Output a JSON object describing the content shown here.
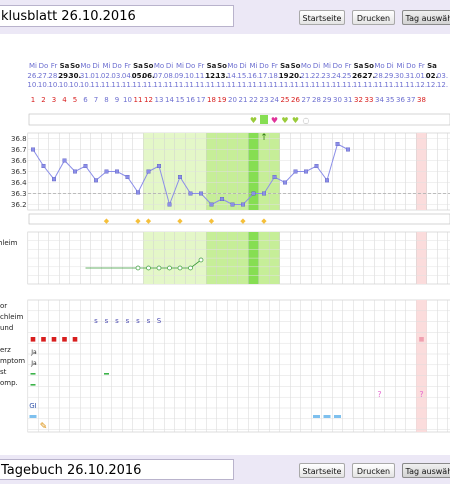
{
  "top": {
    "title": "klusblatt 26.10.2016",
    "buttons": [
      "Startseite",
      "Drucken",
      "Tag auswähl"
    ]
  },
  "bottom": {
    "title": "Tagebuch 26.10.2016",
    "buttons": [
      "Startseite",
      "Drucken",
      "Tag auswähl"
    ]
  },
  "weekdays": [
    "Mi",
    "Do",
    "Fr",
    "Sa",
    "So",
    "Mo",
    "Di",
    "Mi",
    "Do",
    "Fr",
    "Sa",
    "So",
    "Mo",
    "Di",
    "Mi",
    "Do",
    "Fr",
    "Sa",
    "So",
    "Mo",
    "Di",
    "Mi",
    "Do",
    "Fr",
    "Sa",
    "So",
    "Mo",
    "Di",
    "Mi",
    "Do",
    "Fr",
    "Sa",
    "So",
    "Mo",
    "Di",
    "Mi",
    "Do",
    "Fr",
    "Sa"
  ],
  "dates_day": [
    "26.",
    "27.",
    "28.",
    "29.",
    "30.",
    "31.",
    "01.",
    "02.",
    "03.",
    "04.",
    "05.",
    "06.",
    "07.",
    "08.",
    "09.",
    "10.",
    "11.",
    "12.",
    "13.",
    "14.",
    "15.",
    "16.",
    "17.",
    "18.",
    "19.",
    "20.",
    "21.",
    "22.",
    "23.",
    "24.",
    "25.",
    "26.",
    "27.",
    "28.",
    "29.",
    "30.",
    "31.",
    "01.",
    "02.",
    "03."
  ],
  "dates_month": [
    "10.",
    "10.",
    "10.",
    "10.",
    "10.",
    "10.",
    "11.",
    "11.",
    "11.",
    "11.",
    "11.",
    "11.",
    "11.",
    "11.",
    "11.",
    "11.",
    "11.",
    "11.",
    "11.",
    "11.",
    "11.",
    "11.",
    "11.",
    "11.",
    "11.",
    "11.",
    "11.",
    "11.",
    "11.",
    "11.",
    "11.",
    "11.",
    "11.",
    "11.",
    "11.",
    "11.",
    "11.",
    "12.",
    "12.",
    "12."
  ],
  "cycle_days": [
    "1",
    "2",
    "3",
    "4",
    "5",
    "6",
    "7",
    "8",
    "9",
    "10",
    "11",
    "12",
    "13",
    "14",
    "15",
    "16",
    "17",
    "18",
    "19",
    "20",
    "21",
    "22",
    "23",
    "24",
    "25",
    "26",
    "27",
    "28",
    "29",
    "30",
    "31",
    "32",
    "33",
    "34",
    "35",
    "36",
    "37",
    "38"
  ],
  "temp_axis": [
    "36.8",
    "36.7",
    "36.6",
    "36.5",
    "36.4",
    "36.3",
    "36.2"
  ],
  "row_labels": {
    "mucus": "hleim",
    "row1": "or",
    "row2": "chleim",
    "row3": "und",
    "row4": "erz",
    "row5": "mptom",
    "row6": "st",
    "row7": "omp."
  },
  "small_texts": {
    "ja1": "Ja",
    "ja2": "Ja",
    "s_letter": "S",
    "gi": "GI",
    "q1": "?",
    "q2": "?"
  },
  "chart_data": {
    "type": "line",
    "title": "",
    "xlabel": "",
    "ylabel": "",
    "ylim": [
      36.15,
      36.85
    ],
    "series": [
      {
        "values": [
          36.7,
          36.55,
          36.43,
          36.6,
          36.5,
          36.55,
          36.42,
          36.5,
          36.5,
          36.45,
          36.31,
          36.5,
          36.55,
          36.2,
          36.45,
          36.3,
          36.3,
          36.2,
          36.25,
          36.2,
          36.2,
          36.3,
          36.3,
          36.45,
          36.4,
          36.5,
          36.5,
          36.55,
          36.42,
          36.75,
          36.7
        ]
      }
    ],
    "mucus_series": [
      0,
      0,
      0,
      0,
      0,
      0,
      0,
      0,
      0,
      0,
      0,
      1
    ],
    "colors": {
      "fertile": "#e4f7c8",
      "fertile_dark": "#c6ee98",
      "ovulation": "#86de52",
      "period": "#d81e1e",
      "line": "#8b8ee8",
      "future": "#fbdcdc"
    }
  }
}
